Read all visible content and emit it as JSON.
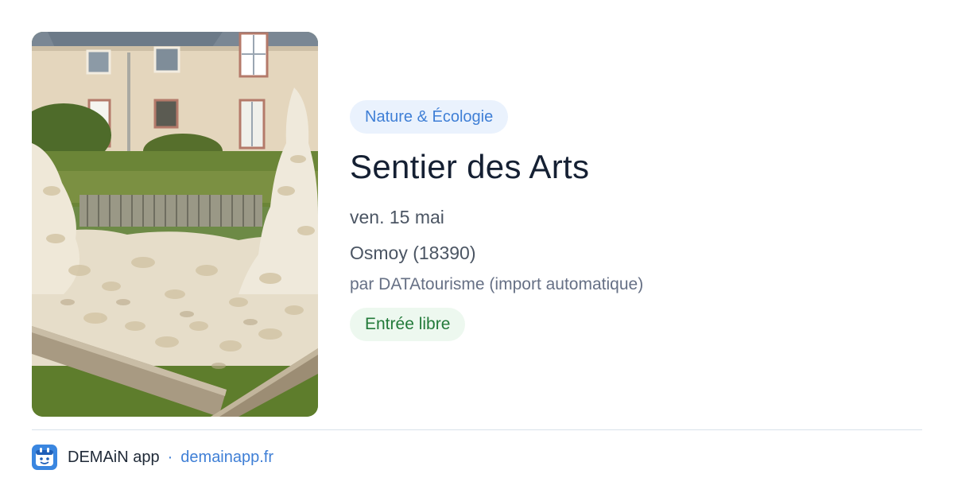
{
  "event": {
    "category": "Nature & Écologie",
    "title": "Sentier des Arts",
    "date": "ven. 15 mai",
    "location": "Osmoy (18390)",
    "author": "par DATAtourisme (import automatique)",
    "price": "Entrée libre"
  },
  "footer": {
    "app_name": "DEMAiN app",
    "separator": "·",
    "url": "demainapp.fr"
  },
  "colors": {
    "accent": "#3f7fd6",
    "title": "#152033",
    "free_badge": "#237a3a"
  }
}
